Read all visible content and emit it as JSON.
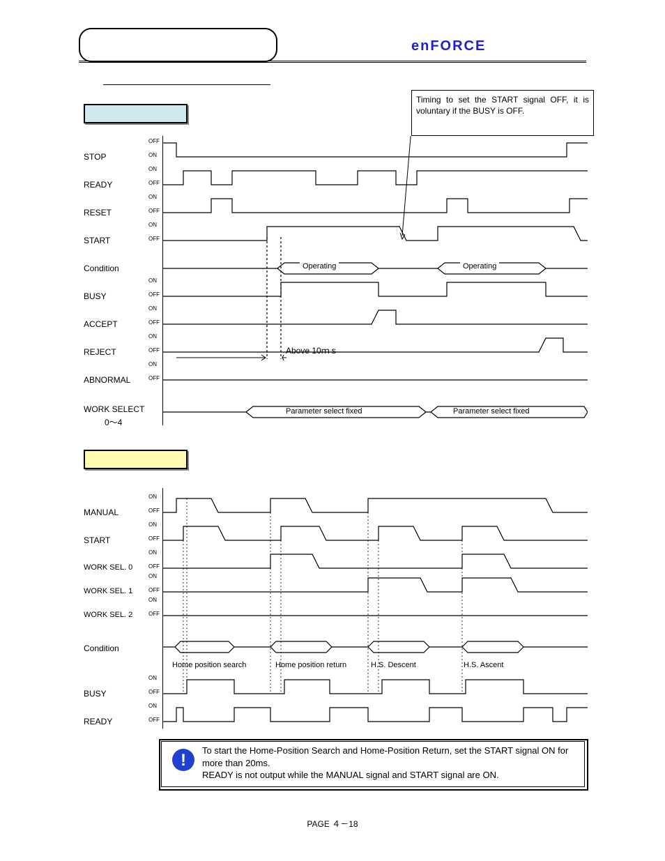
{
  "brand": "enFORCE",
  "callout": "Timing to set the START signal OFF, it is voluntary if the BUSY is OFF.",
  "auto_signals": {
    "stop": "STOP",
    "ready": "READY",
    "reset": "RESET",
    "start": "START",
    "cond": "Condition",
    "busy": "BUSY",
    "accept": "ACCEPT",
    "reject": "REJECT",
    "abnormal": "ABNORMAL",
    "worksel": "WORK SELECT",
    "worksel_sub": "0～4"
  },
  "on_label": "ON",
  "off_label": "OFF",
  "operating": "Operating",
  "above10ms": "Above 10ｍｓ",
  "param_fixed": "Parameter select fixed",
  "manual_signals": {
    "manual": "MANUAL",
    "start": "START",
    "ws0": "WORK SEL. 0",
    "ws1": "WORK SEL. 1",
    "ws2": "WORK SEL. 2",
    "cond": "Condition",
    "busy": "BUSY",
    "ready": "READY"
  },
  "manual_conds": {
    "c1": "Home position search",
    "c2": "Home position return",
    "c3": "H.S. Descent",
    "c4": "H.S. Ascent"
  },
  "note_line1": "To start the Home-Position Search and Home-Position Return, set the START signal ON for more than 20ms.",
  "note_line2": "READY is not output while the MANUAL signal and START signal are ON.",
  "footer_page": "PAGE ４－18"
}
